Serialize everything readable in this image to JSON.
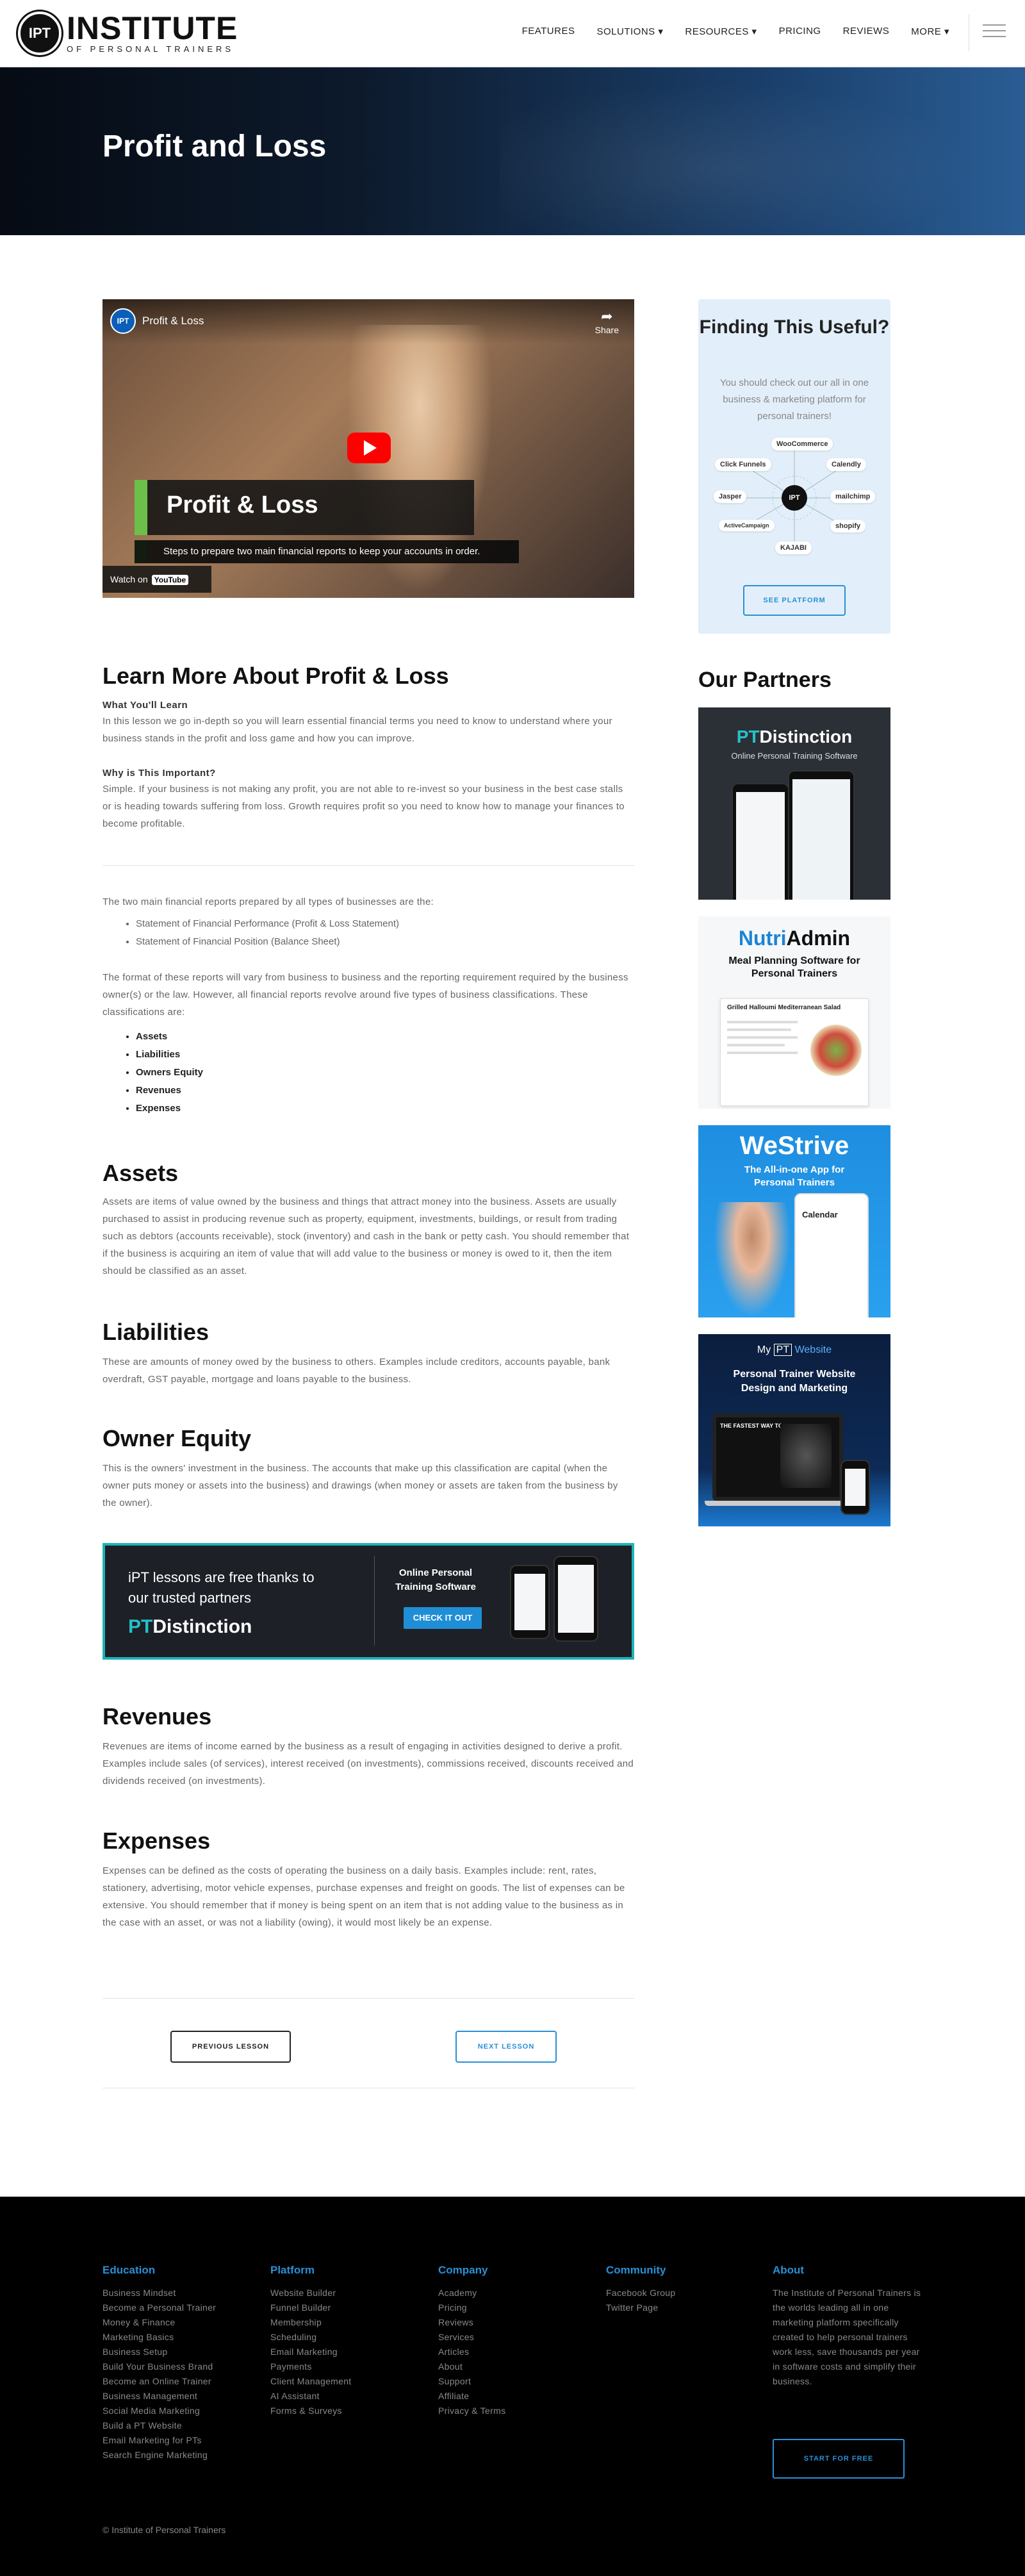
{
  "header": {
    "logo_badge": "IPT",
    "logo_name": "INSTITUTE",
    "logo_sub": "OF PERSONAL TRAINERS",
    "nav": [
      "FEATURES",
      "SOLUTIONS ▾",
      "RESOURCES ▾",
      "PRICING",
      "REVIEWS",
      "MORE ▾"
    ]
  },
  "hero": {
    "title": "Profit and Loss"
  },
  "video": {
    "channel_badge": "IPT",
    "title": "Profit & Loss",
    "share": "Share",
    "lower_title": "Profit & Loss",
    "subtitle": "Steps to prepare two main financial reports to keep your accounts in order.",
    "watch_on": "Watch on",
    "youtube": "YouTube"
  },
  "learn": {
    "heading": "Learn More About Profit & Loss",
    "what_label": "What You'll Learn",
    "what_text": "In this lesson we go in-depth so you will learn essential financial terms you need to know to understand where your business stands in the profit and loss game and how you can improve.",
    "why_label": "Why is This Important?",
    "why_text": "Simple. If your business is not making any profit, you are not able to re-invest so your business in the best case stalls or is heading towards suffering from loss. Growth requires profit so you need to know how to manage your finances to become profitable."
  },
  "reports": {
    "intro": "The two main financial reports prepared by all types of businesses are the:",
    "items": [
      "Statement of Financial Performance (Profit & Loss Statement)",
      "Statement of Financial Position (Balance Sheet)"
    ],
    "format_text": "The format of these reports will vary from business to business and the reporting requirement required by the business owner(s) or the law. However, all financial reports revolve around five types of business classifications. These classifications are:",
    "classes": [
      "Assets",
      "Liabilities",
      "Owners Equity",
      "Revenues",
      "Expenses"
    ]
  },
  "assets": {
    "heading": "Assets",
    "text": "Assets are items of value owned by the business and things that attract money into the business. Assets are usually purchased to assist in producing revenue such as property, equipment, investments, buildings, or result from trading such as debtors (accounts receivable), stock (inventory) and cash in the bank or petty cash. You should remember that if the business is acquiring an item of value that will add value to the business or money is owed to it, then the item should be classified as an asset."
  },
  "liabilities": {
    "heading": "Liabilities",
    "text": "These are amounts of money owed by the business to others. Examples include creditors, accounts payable, bank overdraft, GST payable, mortgage and loans payable to the business."
  },
  "equity": {
    "heading": "Owner Equity",
    "text": "This is the owners' investment in the business. The accounts that make up this classification are capital (when the owner puts money or assets into the business) and drawings (when money or assets are taken from the business by the owner)."
  },
  "promo": {
    "line": "iPT lessons are free thanks to our trusted partners",
    "brand_pt": "PT",
    "brand_rest": "Distinction",
    "right_title": "Online Personal Training Software",
    "button": "CHECK IT OUT"
  },
  "revenues": {
    "heading": "Revenues",
    "text": "Revenues are items of income earned by the business as a result of engaging in activities designed to derive a profit. Examples include sales (of services), interest received (on investments), commissions received, discounts received and dividends received (on investments)."
  },
  "expenses": {
    "heading": "Expenses",
    "text": "Expenses can be defined as the costs of operating the business on a daily basis. Examples include: rent, rates, stationery, advertising, motor vehicle expenses, purchase expenses and freight on goods. The list of expenses can be extensive. You should remember that if money is being spent on an item that is not adding value to the business as in the case with an asset, or was not a liability (owing), it would most likely be an expense."
  },
  "lesson_nav": {
    "prev": "PREVIOUS LESSON",
    "next": "NEXT LESSON"
  },
  "sidebar": {
    "title": "Finding This Useful?",
    "text": "You should check out our all in one business & marketing platform for personal trainers!",
    "hub_center": "IPT",
    "hub_nodes": [
      "WooCommerce",
      "Click Funnels",
      "Calendly",
      "Jasper",
      "mailchimp",
      "ActiveCampaign",
      "shopify",
      "KAJABI"
    ],
    "button": "SEE PLATFORM",
    "partners_heading": "Our Partners",
    "ads": {
      "pt_brand_pt": "PT",
      "pt_brand_rest": "Distinction",
      "pt_sub": "Online Personal Training Software",
      "nutri_a": "Nutri",
      "nutri_b": "Admin",
      "nutri_sub": "Meal Planning Software for Personal Trainers",
      "nutri_card": "Grilled Halloumi Mediterranean Salad",
      "westrive": "WeStrive",
      "westrive_sub": "The All-in-one App for Personal Trainers",
      "westrive_cal": "Calendar",
      "mypt_a": "My",
      "mypt_b": "PT",
      "mypt_c": "Website",
      "mypt_sub": "Personal Trainer Website Design and Marketing",
      "mypt_screen": "THE FASTEST WAY TO"
    }
  },
  "footer": {
    "cols": [
      {
        "title": "Education",
        "links": [
          "Business Mindset",
          "Become a Personal Trainer",
          "Money & Finance",
          "Marketing Basics",
          "Business Setup",
          "Build Your Business Brand",
          "Become an Online Trainer",
          "Business Management",
          "Social Media Marketing",
          "Build a PT Website",
          "Email Marketing for PTs",
          "Search Engine Marketing"
        ]
      },
      {
        "title": "Platform",
        "links": [
          "Website Builder",
          "Funnel Builder",
          "Membership",
          "Scheduling",
          "Email Marketing",
          "Payments",
          "Client Management",
          "AI Assistant",
          "Forms & Surveys"
        ]
      },
      {
        "title": "Company",
        "links": [
          "Academy",
          "Pricing",
          "Reviews",
          "Services",
          "Articles",
          "About",
          "Support",
          "Affiliate",
          "Privacy & Terms"
        ]
      },
      {
        "title": "Community",
        "links": [
          "Facebook Group",
          "Twitter Page"
        ]
      }
    ],
    "about_title": "About",
    "about_text": "The Institute of Personal Trainers is the worlds leading all in one marketing platform specifically created to help personal trainers work less, save thousands per year in software costs and simplify their business.",
    "about_button": "START FOR FREE",
    "copyright": "© Institute of Personal Trainers"
  }
}
